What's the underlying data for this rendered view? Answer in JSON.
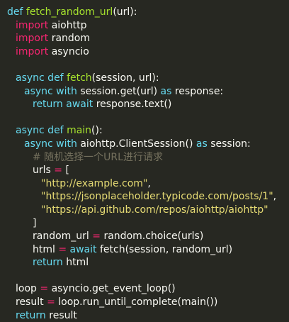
{
  "code": {
    "l1": {
      "kw": "def",
      "name": "fetch_random_url",
      "rest": "(url):"
    },
    "l2": {
      "kw": "import",
      "mod": "aiohttp"
    },
    "l3": {
      "kw": "import",
      "mod": "random"
    },
    "l4": {
      "kw": "import",
      "mod": "asyncio"
    },
    "l6": {
      "kw": "async def",
      "name": "fetch",
      "rest": "(session, url):"
    },
    "l7": {
      "kw": "async with",
      "a": "session.get(url)",
      "as": "as",
      "b": "response:"
    },
    "l8": {
      "kw": "return await",
      "rest": "response.text()"
    },
    "l10": {
      "kw": "async def",
      "name": "main",
      "rest": "():"
    },
    "l11": {
      "kw": "async with",
      "a": "aiohttp.ClientSession()",
      "as": "as",
      "b": "session:"
    },
    "l12": {
      "comment": "# 随机选择一个URL进行请求"
    },
    "l13": {
      "a": "urls",
      "op": "=",
      "b": "["
    },
    "l14": {
      "str": "\"http://example.com\"",
      "rest": ","
    },
    "l15": {
      "str": "\"https://jsonplaceholder.typicode.com/posts/1\"",
      "rest": ","
    },
    "l16": {
      "str": "\"https://api.github.com/repos/aiohttp/aiohttp\""
    },
    "l17": {
      "a": "]"
    },
    "l18": {
      "a": "random_url",
      "op": "=",
      "b": "random.choice(urls)"
    },
    "l19": {
      "a": "html",
      "op": "=",
      "kw": "await",
      "b": "fetch(session, random_url)"
    },
    "l20": {
      "kw": "return",
      "b": "html"
    },
    "l22": {
      "a": "loop",
      "op": "=",
      "b": "asyncio.get_event_loop()"
    },
    "l23": {
      "a": "result",
      "op": "=",
      "b": "loop.run_until_complete(main())"
    },
    "l24": {
      "kw": "return",
      "b": "result"
    }
  }
}
